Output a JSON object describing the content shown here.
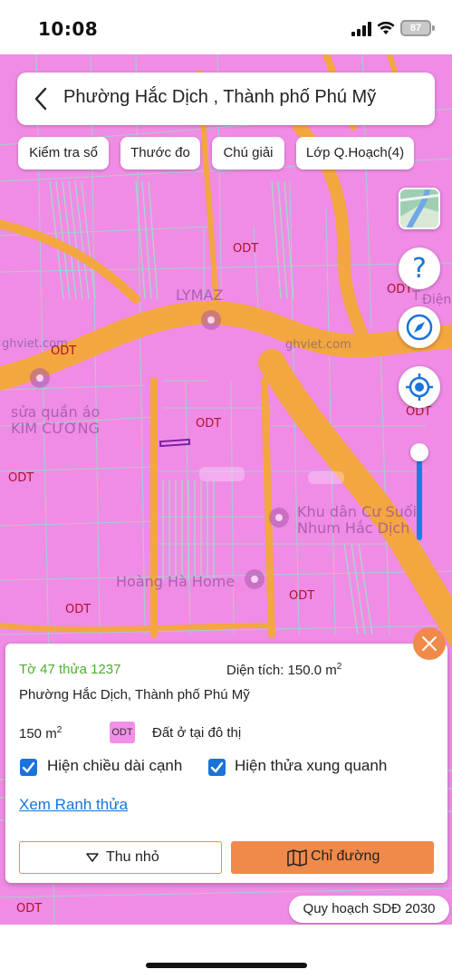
{
  "status_bar": {
    "time": "10:08",
    "battery": "87",
    "icons": [
      "signal-icon",
      "wifi-icon",
      "battery-icon"
    ]
  },
  "header": {
    "title": "Phường Hắc Dịch , Thành phố Phú Mỹ",
    "back_icon": "chevron-left-icon"
  },
  "toolbar": {
    "check_book": "Kiểm tra sổ",
    "ruler": "Thước đo",
    "legend": "Chú giải",
    "planning_layer": "Lớp Q.Hoạch(4)"
  },
  "map": {
    "zone_labels": [
      "ODT",
      "ODT",
      "ODT",
      "ODT",
      "ODT",
      "ODT",
      "ODT",
      "ODT",
      "ODT"
    ],
    "watermarks": [
      "ghviet.com",
      "ghviet.com"
    ],
    "pois": {
      "lymaz": "LYMAZ",
      "clothes_1": "sửa quần áo",
      "clothes_2": "KIM CƯƠNG",
      "residential_1": "Khu dân Cư Suối",
      "residential_2": "Nhum Hắc Dịch",
      "hoang_ha": "Hoàng Hà Home",
      "dien_partial": "Điện",
      "t_partial": "T"
    },
    "zoom_level": 0.88,
    "colors": {
      "land": "#f08ce6",
      "road": "#f4a640",
      "parcel_line": "#9fd8c8",
      "selected_parcel": "#7a1fa0"
    }
  },
  "controls": {
    "help": "?",
    "icons": [
      "map-layer-icon",
      "help-icon",
      "compass-icon",
      "my-location-icon"
    ]
  },
  "panel": {
    "parcel_id": "Tờ 47 thửa 1237",
    "area_label": "Diện tích: 150.0 m",
    "area_sup": "2",
    "address": "Phường Hắc Dịch, Thành phố Phú Mỹ",
    "area_short": "150 m",
    "area_short_sup": "2",
    "land_code": "ODT",
    "land_type": "Đất ở tại đô thị",
    "show_edges": "Hiện chiều dài cạnh",
    "show_edges_checked": true,
    "show_neighbors": "Hiện thửa xung quanh",
    "show_neighbors_checked": true,
    "view_boundary": "Xem Ranh thửa",
    "shrink_button": "Thu nhỏ",
    "directions_button": "Chỉ đường",
    "colors": {
      "accent": "#f08a4b",
      "parcel_id": "#4caf2e",
      "link": "#1a73d9"
    }
  },
  "plan_chip": "Quy hoạch SDĐ 2030"
}
